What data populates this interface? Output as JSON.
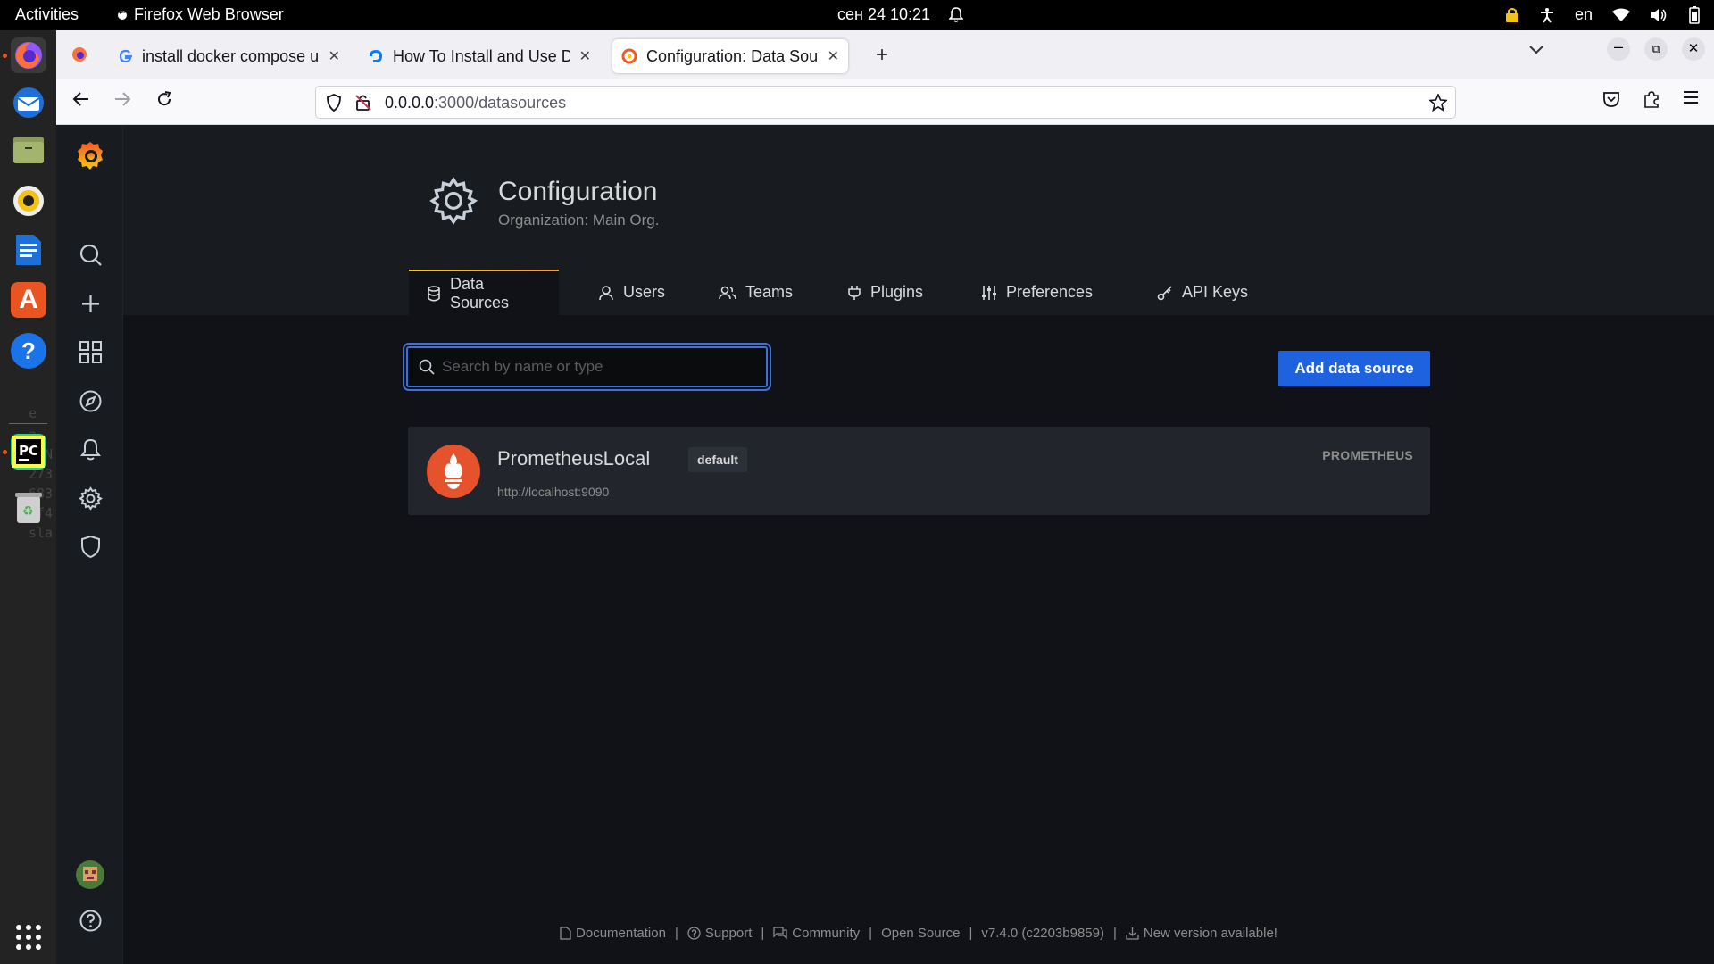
{
  "system_bar": {
    "activities": "Activities",
    "app_name": "Firefox Web Browser",
    "clock": "сен 24  10:21",
    "language": "en"
  },
  "browser": {
    "tabs": [
      {
        "title": "install docker compose ul",
        "icon": "google-icon"
      },
      {
        "title": "How To Install and Use Do",
        "icon": "digitalocean-icon"
      },
      {
        "title": "Configuration: Data Sour",
        "icon": "grafana-icon",
        "active": true
      }
    ],
    "url_host": "0.0.0.0",
    "url_path": ":3000/datasources"
  },
  "page": {
    "title": "Configuration",
    "subtitle": "Organization: Main Org.",
    "tabs": [
      {
        "label": "Data Sources",
        "icon": "database-icon",
        "active": true
      },
      {
        "label": "Users",
        "icon": "user-icon"
      },
      {
        "label": "Teams",
        "icon": "users-icon"
      },
      {
        "label": "Plugins",
        "icon": "plug-icon"
      },
      {
        "label": "Preferences",
        "icon": "sliders-icon"
      },
      {
        "label": "API Keys",
        "icon": "key-icon"
      }
    ],
    "search_placeholder": "Search by name or type",
    "add_button": "Add data source",
    "datasource": {
      "name": "PrometheusLocal",
      "badge": "default",
      "url": "http://localhost:9090",
      "type": "PROMETHEUS"
    },
    "footer": {
      "documentation": "Documentation",
      "support": "Support",
      "community": "Community",
      "open_source": "Open Source",
      "version": "v7.4.0 (c2203b9859)",
      "new_version": "New version available!"
    }
  },
  "colors": {
    "accent_blue": "#1f62e0",
    "grafana_orange": "#f05a28",
    "background": "#111217",
    "card": "#22252b"
  }
}
